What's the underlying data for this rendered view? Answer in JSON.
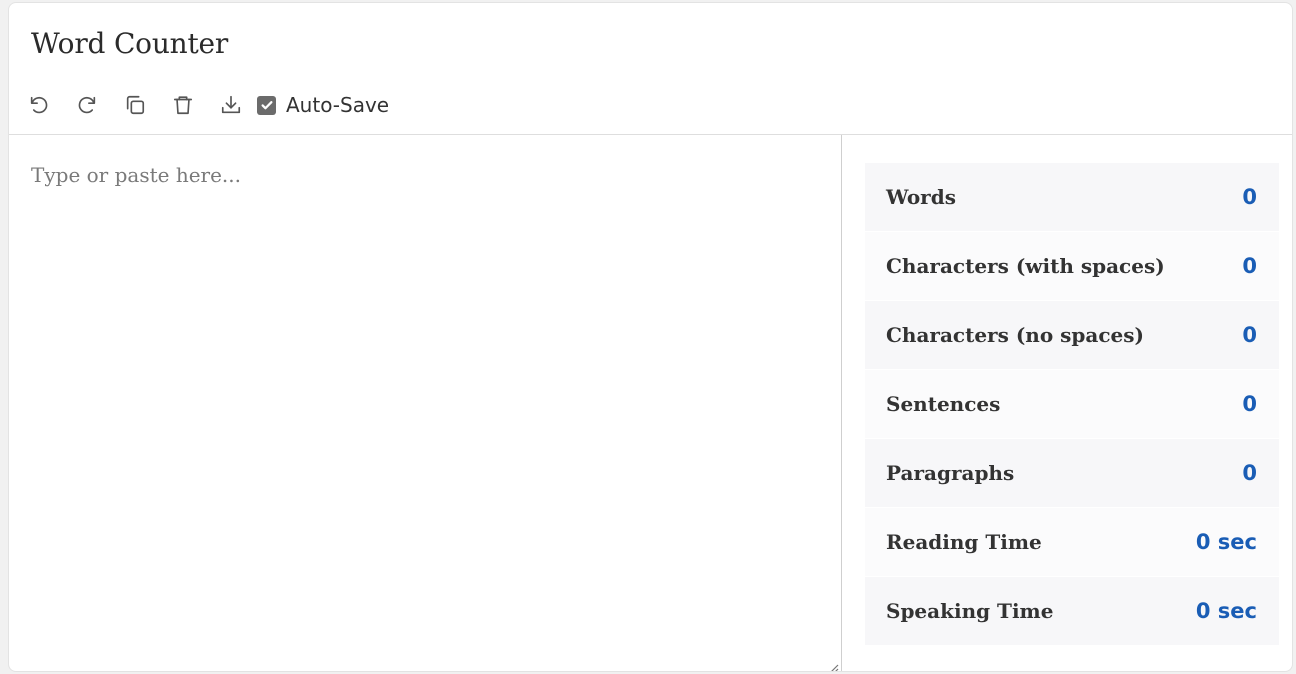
{
  "app": {
    "title": "Word Counter"
  },
  "toolbar": {
    "undo_icon": "undo-icon",
    "redo_icon": "redo-icon",
    "copy_icon": "copy-icon",
    "delete_icon": "trash-icon",
    "download_icon": "download-icon",
    "autosave_label": "Auto-Save",
    "autosave_checked": true
  },
  "editor": {
    "placeholder": "Type or paste here...",
    "value": ""
  },
  "stats": [
    {
      "label": "Words",
      "value": "0"
    },
    {
      "label": "Characters (with spaces)",
      "value": "0"
    },
    {
      "label": "Characters (no spaces)",
      "value": "0"
    },
    {
      "label": "Sentences",
      "value": "0"
    },
    {
      "label": "Paragraphs",
      "value": "0"
    },
    {
      "label": "Reading Time",
      "value": "0 sec"
    },
    {
      "label": "Speaking Time",
      "value": "0 sec"
    }
  ],
  "colors": {
    "accent": "#1a5db5",
    "checkbox": "#6b6b6b"
  }
}
